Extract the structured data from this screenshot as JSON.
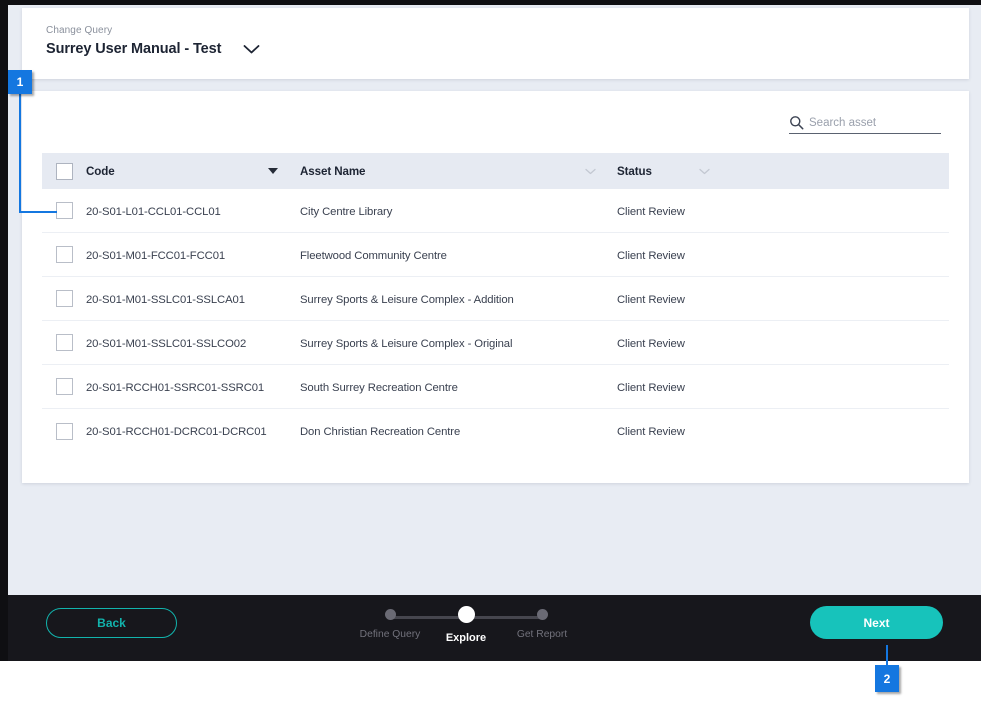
{
  "query": {
    "label": "Change Query",
    "title": "Surrey User Manual - Test",
    "chevron_icon": "chevron-down-icon"
  },
  "search": {
    "icon": "search-icon",
    "placeholder": "Search asset",
    "value": ""
  },
  "table": {
    "columns": [
      {
        "key": "select",
        "label": "",
        "sort_icon": ""
      },
      {
        "key": "code",
        "label": "Code",
        "sort_icon": "sort-descending-triangle-icon"
      },
      {
        "key": "asset_name",
        "label": "Asset Name",
        "sort_icon": "chevron-down-icon"
      },
      {
        "key": "status",
        "label": "Status",
        "sort_icon": "chevron-down-icon"
      }
    ],
    "rows": [
      {
        "code": "20-S01-L01-CCL01-CCL01",
        "asset_name": "City Centre Library",
        "status": "Client Review",
        "checked": false
      },
      {
        "code": "20-S01-M01-FCC01-FCC01",
        "asset_name": "Fleetwood Community Centre",
        "status": "Client Review",
        "checked": false
      },
      {
        "code": "20-S01-M01-SSLC01-SSLCA01",
        "asset_name": "Surrey Sports & Leisure Complex - Addition",
        "status": "Client Review",
        "checked": false
      },
      {
        "code": "20-S01-M01-SSLC01-SSLCO02",
        "asset_name": "Surrey Sports & Leisure Complex - Original",
        "status": "Client Review",
        "checked": false
      },
      {
        "code": "20-S01-RCCH01-SSRC01-SSRC01",
        "asset_name": "South Surrey Recreation Centre",
        "status": "Client Review",
        "checked": false
      },
      {
        "code": "20-S01-RCCH01-DCRC01-DCRC01",
        "asset_name": "Don Christian Recreation Centre",
        "status": "Client Review",
        "checked": false
      }
    ]
  },
  "footer": {
    "back_label": "Back",
    "next_label": "Next",
    "steps": [
      {
        "label": "Define Query",
        "active": false
      },
      {
        "label": "Explore",
        "active": true
      },
      {
        "label": "Get Report",
        "active": false
      }
    ]
  },
  "callouts": [
    {
      "number": "1"
    },
    {
      "number": "2"
    }
  ],
  "colors": {
    "accent_teal": "#17c3bb",
    "callout_blue": "#1477e0",
    "page_bg": "#e8ecf3",
    "footer_bg": "#17171c",
    "header_row_bg": "#e6eaf2"
  }
}
